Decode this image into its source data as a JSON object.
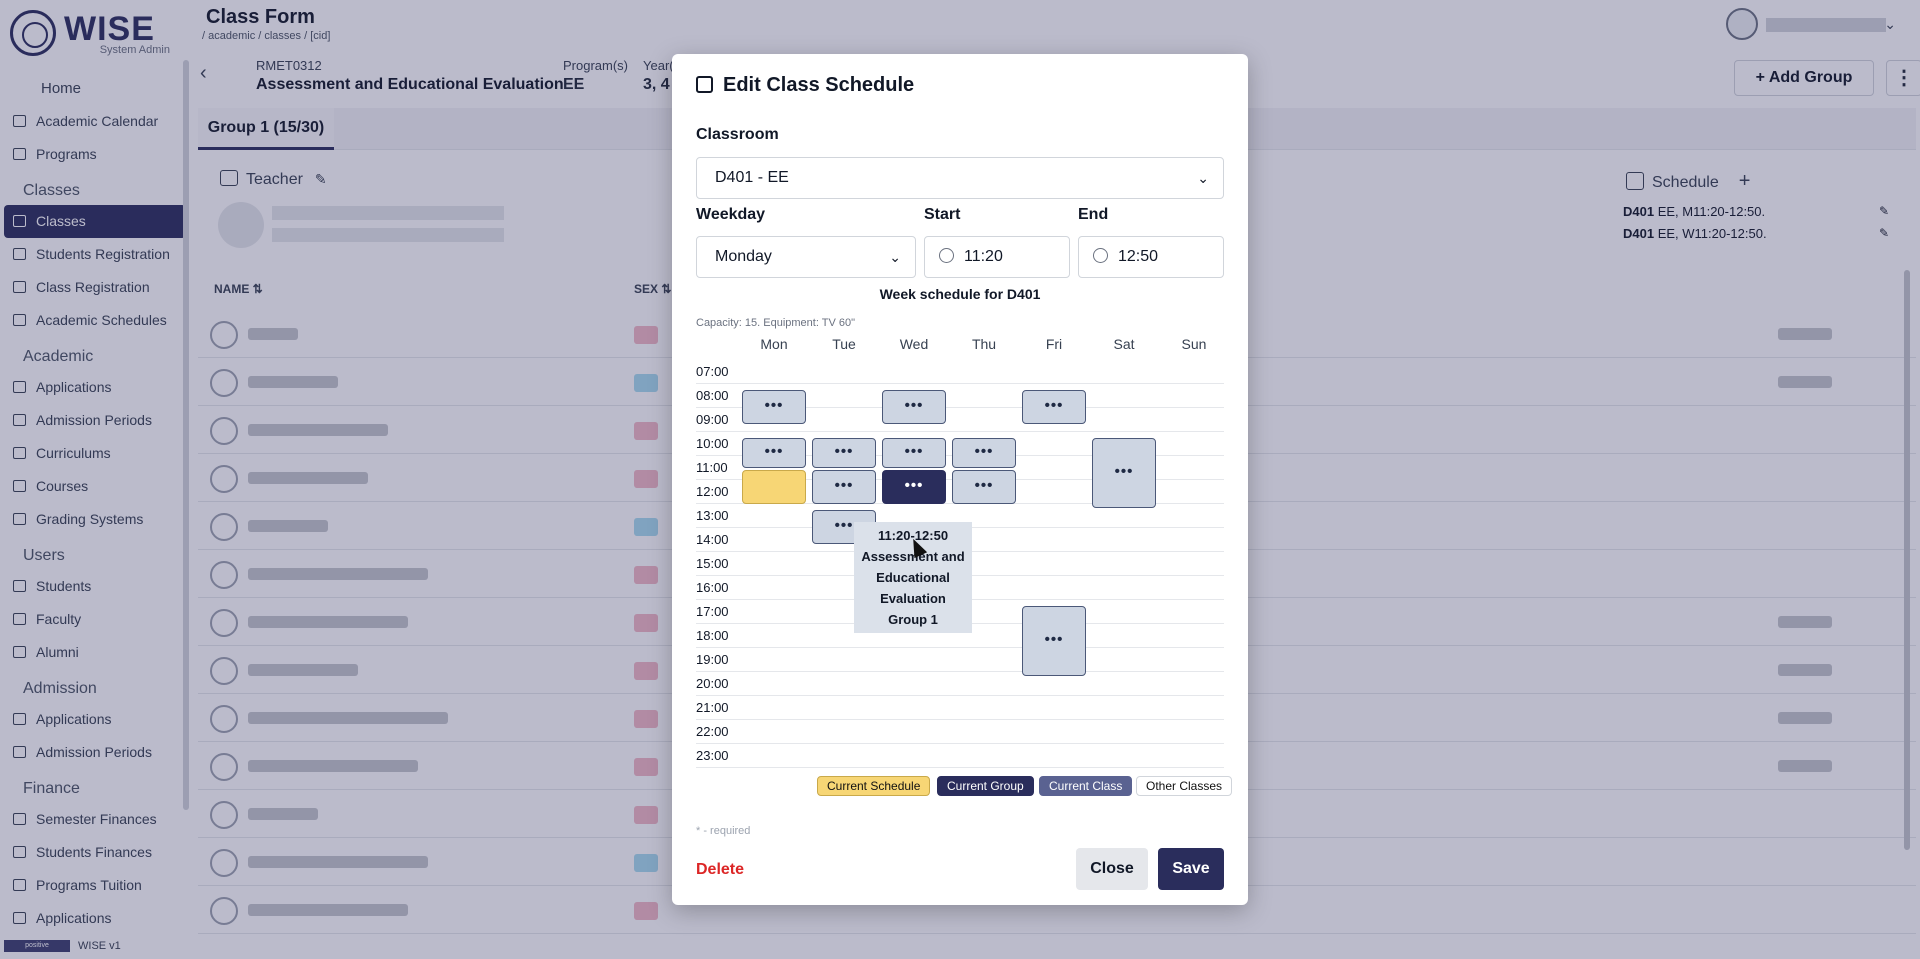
{
  "brand": {
    "name": "WISE",
    "role": "System Admin"
  },
  "nav": [
    {
      "type": "item",
      "label": "Home",
      "icon": "home-icon",
      "plain": true
    },
    {
      "type": "item",
      "label": "Academic Calendar",
      "icon": "calendar-icon"
    },
    {
      "type": "item",
      "label": "Programs",
      "icon": "building-icon"
    },
    {
      "type": "sec",
      "label": "Classes"
    },
    {
      "type": "item",
      "label": "Classes",
      "icon": "classes-icon",
      "active": true
    },
    {
      "type": "item",
      "label": "Students Registration",
      "icon": "user-add-icon"
    },
    {
      "type": "item",
      "label": "Class Registration",
      "icon": "clipboard-icon"
    },
    {
      "type": "item",
      "label": "Academic Schedules",
      "icon": "calendar-icon"
    },
    {
      "type": "sec",
      "label": "Academic"
    },
    {
      "type": "item",
      "label": "Applications",
      "icon": "document-icon"
    },
    {
      "type": "item",
      "label": "Admission Periods",
      "icon": "calendar-icon"
    },
    {
      "type": "item",
      "label": "Curriculums",
      "icon": "book-icon"
    },
    {
      "type": "item",
      "label": "Courses",
      "icon": "book-icon"
    },
    {
      "type": "item",
      "label": "Grading Systems",
      "icon": "grade-icon"
    },
    {
      "type": "sec",
      "label": "Users"
    },
    {
      "type": "item",
      "label": "Students",
      "icon": "user-icon"
    },
    {
      "type": "item",
      "label": "Faculty",
      "icon": "briefcase-icon"
    },
    {
      "type": "item",
      "label": "Alumni",
      "icon": "graduation-icon"
    },
    {
      "type": "sec",
      "label": "Admission"
    },
    {
      "type": "item",
      "label": "Applications",
      "icon": "document-icon"
    },
    {
      "type": "item",
      "label": "Admission Periods",
      "icon": "calendar-icon"
    },
    {
      "type": "sec",
      "label": "Finance"
    },
    {
      "type": "item",
      "label": "Semester Finances",
      "icon": "money-icon"
    },
    {
      "type": "item",
      "label": "Students Finances",
      "icon": "money-icon"
    },
    {
      "type": "item",
      "label": "Programs Tuition",
      "icon": "money-icon"
    },
    {
      "type": "item",
      "label": "Applications",
      "icon": "document-icon"
    }
  ],
  "footer": {
    "logo_text": "positive",
    "version": "WISE v1"
  },
  "header": {
    "title": "Class Form",
    "breadcrumb": "/ academic / classes / [cid]"
  },
  "classbar": {
    "back": "‹",
    "code": "RMET0312",
    "name": "Assessment and Educational Evaluation",
    "programs_label": "Program(s)",
    "programs": "EE",
    "years_label": "Year(s)",
    "years": "3, 4",
    "add_group": "+  Add Group",
    "more": "⋮"
  },
  "tabs": [
    {
      "label": "Group 1 (15/30)"
    }
  ],
  "teacher": {
    "label": "Teacher"
  },
  "schedule_panel": {
    "label": "Schedule",
    "plus": "+",
    "lines": [
      {
        "room": "D401",
        "rest": " EE, M11:20-12:50."
      },
      {
        "room": "D401",
        "rest": " EE, W11:20-12:50."
      }
    ]
  },
  "table": {
    "col_name": "NAME ⇅",
    "col_sex": "SEX ⇅"
  },
  "modal": {
    "title": "Edit Class Schedule",
    "classroom_label": "Classroom",
    "classroom_value": "D401 - EE",
    "weekday_label": "Weekday",
    "weekday_value": "Monday",
    "start_label": "Start",
    "start_value": "11:20",
    "end_label": "End",
    "end_value": "12:50",
    "week_title": "Week schedule for D401",
    "capacity": "Capacity: 15. Equipment: TV 60\"",
    "days": [
      "Mon",
      "Tue",
      "Wed",
      "Thu",
      "Fri",
      "Sat",
      "Sun"
    ],
    "hours": [
      "07:00",
      "08:00",
      "09:00",
      "10:00",
      "11:00",
      "12:00",
      "13:00",
      "14:00",
      "15:00",
      "16:00",
      "17:00",
      "18:00",
      "19:00",
      "20:00",
      "21:00",
      "22:00",
      "23:00"
    ],
    "blocks": [
      {
        "day": 0,
        "start": 8.0,
        "end": 9.5,
        "kind": "other",
        "label": "•••"
      },
      {
        "day": 2,
        "start": 8.0,
        "end": 9.5,
        "kind": "other",
        "label": "•••"
      },
      {
        "day": 4,
        "start": 8.0,
        "end": 9.5,
        "kind": "other",
        "label": "•••"
      },
      {
        "day": 0,
        "start": 10.0,
        "end": 11.33,
        "kind": "other",
        "label": "•••"
      },
      {
        "day": 1,
        "start": 10.0,
        "end": 11.33,
        "kind": "other",
        "label": "•••"
      },
      {
        "day": 2,
        "start": 10.0,
        "end": 11.33,
        "kind": "other",
        "label": "•••"
      },
      {
        "day": 3,
        "start": 10.0,
        "end": 11.33,
        "kind": "other",
        "label": "•••"
      },
      {
        "day": 5,
        "start": 10.0,
        "end": 13.0,
        "kind": "other",
        "label": "•••"
      },
      {
        "day": 0,
        "start": 11.33,
        "end": 12.83,
        "kind": "current",
        "label": ""
      },
      {
        "day": 1,
        "start": 11.33,
        "end": 12.83,
        "kind": "other",
        "label": "•••"
      },
      {
        "day": 2,
        "start": 11.33,
        "end": 12.83,
        "kind": "group",
        "label": "•••"
      },
      {
        "day": 3,
        "start": 11.33,
        "end": 12.83,
        "kind": "other",
        "label": "•••"
      },
      {
        "day": 1,
        "start": 13.0,
        "end": 14.5,
        "kind": "other",
        "label": "•••"
      },
      {
        "day": 4,
        "start": 17.0,
        "end": 20.0,
        "kind": "other",
        "label": "•••"
      }
    ],
    "tooltip": [
      "11:20-12:50",
      "Assessment and",
      "Educational",
      "Evaluation",
      "Group 1"
    ],
    "legend": {
      "current_schedule": "Current Schedule",
      "current_group": "Current Group",
      "current_class": "Current Class",
      "other_classes": "Other Classes"
    },
    "required_note": "* - required",
    "delete_label": "Delete",
    "close_label": "Close",
    "save_label": "Save"
  },
  "colors": {
    "primary": "#2a2d5c",
    "current_schedule": "#f7d675",
    "other_block": "#cdd5e2",
    "danger": "#dc2626"
  }
}
